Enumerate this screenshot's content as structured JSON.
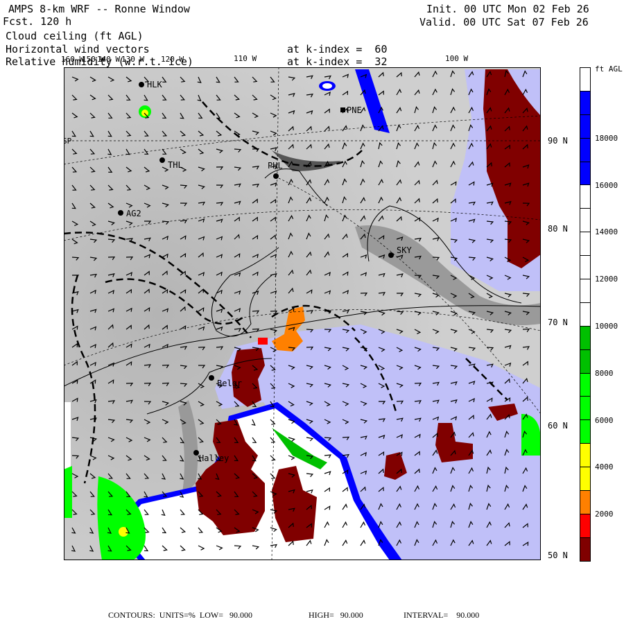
{
  "header": {
    "title": "AMPS 8-km WRF -- Ronne Window",
    "forecast": "Fcst. 120 h",
    "init": "Init. 00 UTC Mon 02 Feb 26",
    "valid": "Valid. 00 UTC Sat 07 Feb 26",
    "fields": [
      {
        "label": "Cloud ceiling (ft AGL)",
        "level": ""
      },
      {
        "label": "Horizontal wind vectors",
        "level": "at k-index =  60"
      },
      {
        "label": "Relative humidity (w.r.t. ice)",
        "level": "at k-index =  32"
      }
    ]
  },
  "map": {
    "lon_labels": [
      "160 W",
      "150 W",
      "140 W",
      "130 W",
      "120 W",
      "110 W",
      "100 W"
    ],
    "lat_labels": [
      "90 N",
      "80 N",
      "70 N",
      "60 N",
      "50 N"
    ],
    "stations": [
      "HLK",
      "PNE",
      "THL",
      "PHL",
      "AG2",
      "SKY",
      "Belgr",
      "Halley",
      "SP"
    ]
  },
  "colorbar": {
    "units": "ft AGL",
    "labels": [
      "18000",
      "16000",
      "14000",
      "12000",
      "10000",
      "8000",
      "6000",
      "4000",
      "2000"
    ],
    "colors": [
      "#ffffff",
      "#0000ff",
      "#0000ff",
      "#0000ff",
      "#0000ff",
      "#ffffff",
      "#ffffff",
      "#ffffff",
      "#ffffff",
      "#ffffff",
      "#ffffff",
      "#00c000",
      "#00c000",
      "#00ff00",
      "#00ff00",
      "#00ff00",
      "#ffff00",
      "#ffff00",
      "#ff8000",
      "#ff0000",
      "#800000"
    ]
  },
  "footer": {
    "contours": "CONTOURS:  UNITS=%  LOW=   90.000",
    "high": "HIGH=   90.000",
    "interval": "INTERVAL=    90.000"
  }
}
